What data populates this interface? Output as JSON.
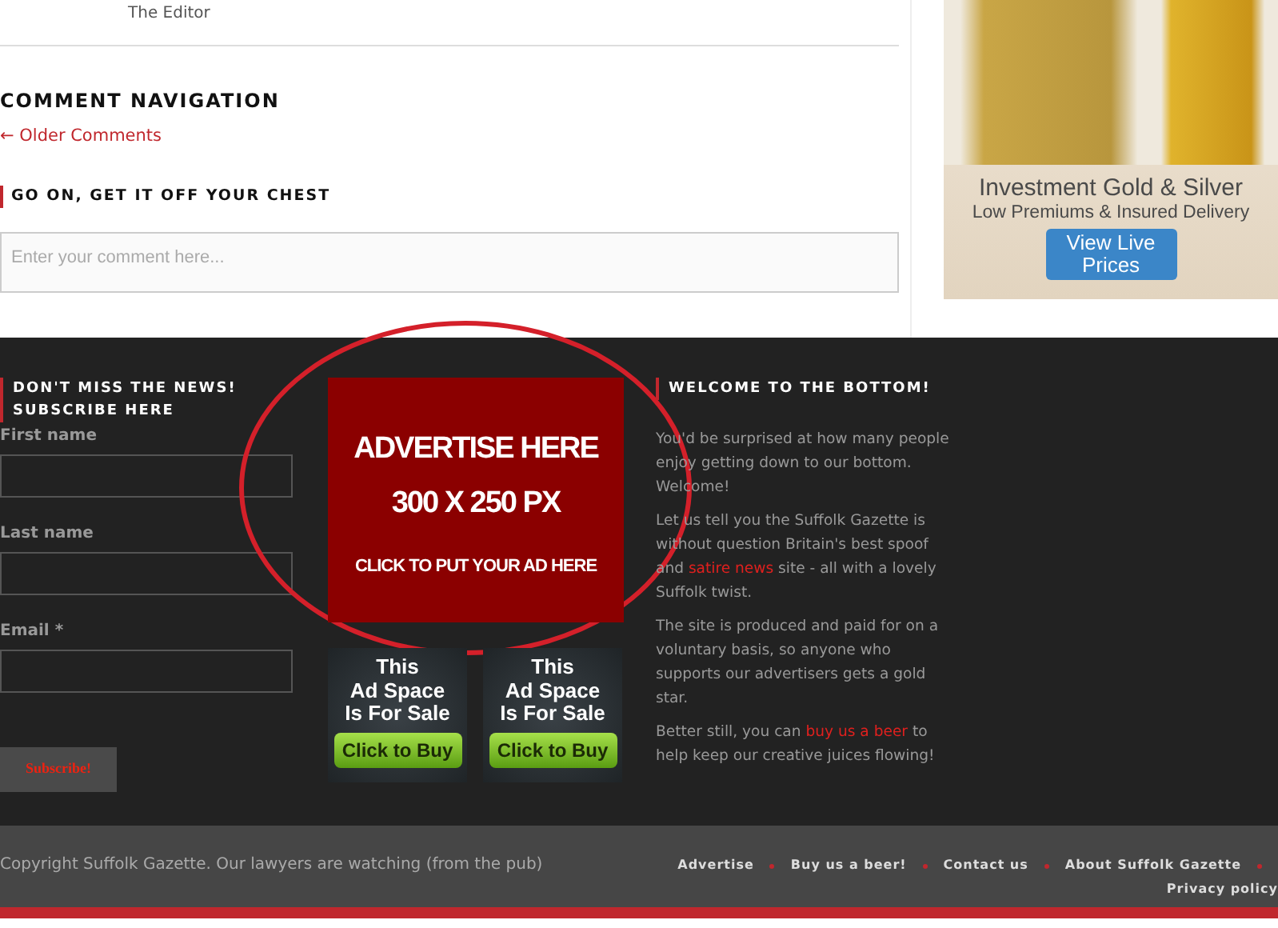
{
  "article": {
    "author": "The Editor"
  },
  "comment_navigation": {
    "title": "COMMENT NAVIGATION",
    "older_link": "← Older Comments"
  },
  "reply": {
    "title": "GO ON, GET IT OFF YOUR CHEST",
    "placeholder": "Enter your comment here..."
  },
  "sidebar_ad": {
    "headline": "Investment Gold & Silver",
    "subline": "Low Premiums & Insured Delivery",
    "button": "View Live Prices"
  },
  "footer": {
    "newsletter": {
      "title_lines": [
        "DON'T MISS THE NEWS!",
        "SUBSCRIBE HERE"
      ],
      "fields": [
        {
          "label": "First name"
        },
        {
          "label": "Last name"
        },
        {
          "label": "Email *"
        }
      ],
      "button": "Subscribe!"
    },
    "ads": {
      "main": [
        "ADVERTISE HERE",
        "300 X 250 PX",
        "CLICK TO PUT YOUR AD HERE"
      ],
      "small": [
        {
          "lines": [
            "This",
            "Ad Space",
            "Is For Sale"
          ],
          "button": "Click to Buy"
        },
        {
          "lines": [
            "This",
            "Ad Space",
            "Is For Sale"
          ],
          "button": "Click to Buy"
        }
      ]
    },
    "welcome": {
      "title": "WELCOME TO THE BOTTOM!",
      "paragraphs": [
        [
          {
            "kind": "text",
            "text": "You'd be surprised at how many people enjoy getting down to our bottom. Welcome!"
          }
        ],
        [
          {
            "kind": "text",
            "text": "Let us tell you the Suffolk Gazette is without question Britain's best spoof and "
          },
          {
            "kind": "link",
            "text": "satire news"
          },
          {
            "kind": "text",
            "text": " site - all with a lovely Suffolk twist."
          }
        ],
        [
          {
            "kind": "text",
            "text": "The site is produced and paid for on a voluntary basis, so anyone who supports our advertisers gets a gold star."
          }
        ],
        [
          {
            "kind": "text",
            "text": "Better still, you can "
          },
          {
            "kind": "link",
            "text": "buy us a beer"
          },
          {
            "kind": "text",
            "text": " to help keep our creative juices flowing!"
          }
        ]
      ]
    }
  },
  "bottom_bar": {
    "copyright": "Copyright Suffolk Gazette. Our lawyers are watching (from the pub)",
    "links": [
      "Advertise",
      "Buy us a beer!",
      "Contact us",
      "About Suffolk Gazette",
      "Privacy policy"
    ]
  }
}
